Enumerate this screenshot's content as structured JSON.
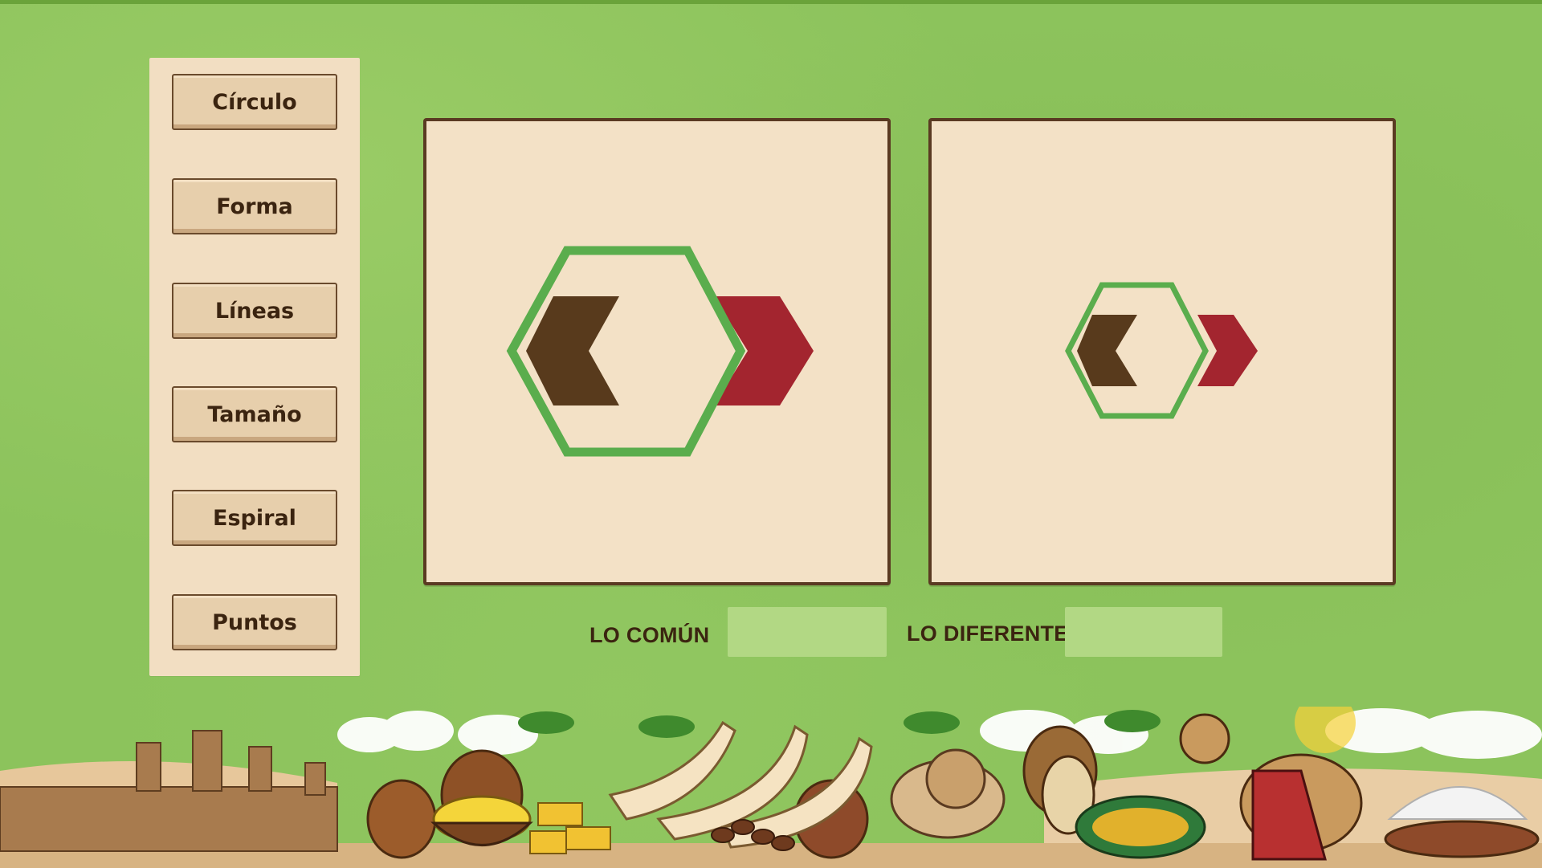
{
  "sidebar": {
    "items": [
      {
        "label": "Círculo"
      },
      {
        "label": "Forma"
      },
      {
        "label": "Líneas"
      },
      {
        "label": "Tamaño"
      },
      {
        "label": "Espiral"
      },
      {
        "label": "Puntos"
      }
    ]
  },
  "cards": [
    {
      "size": "large",
      "hexagon_color": "#5aad4d",
      "left_chevron_color": "#583a1c",
      "right_chevron_color": "#a3252f"
    },
    {
      "size": "small",
      "hexagon_color": "#5aad4d",
      "left_chevron_color": "#583a1c",
      "right_chevron_color": "#a3252f"
    }
  ],
  "answers": {
    "common_label": "LO COMÚN",
    "different_label": "LO DIFERENTE",
    "common_value": "",
    "different_value": ""
  },
  "colors": {
    "background": "#8cc35c",
    "panel": "#f2dec2",
    "card": "#f3e1c6",
    "text": "#3b2410"
  },
  "scenery_icons": [
    "city-walls-icon",
    "clay-pot-icon",
    "gold-bowl-icon",
    "gold-bars-icon",
    "palm-tree-icon",
    "ivory-tusk-icon",
    "dates-bowl-icon",
    "lion-statue-icon",
    "tribal-mask-icon",
    "woven-basket-icon",
    "camel-icon",
    "salt-pile-icon"
  ]
}
